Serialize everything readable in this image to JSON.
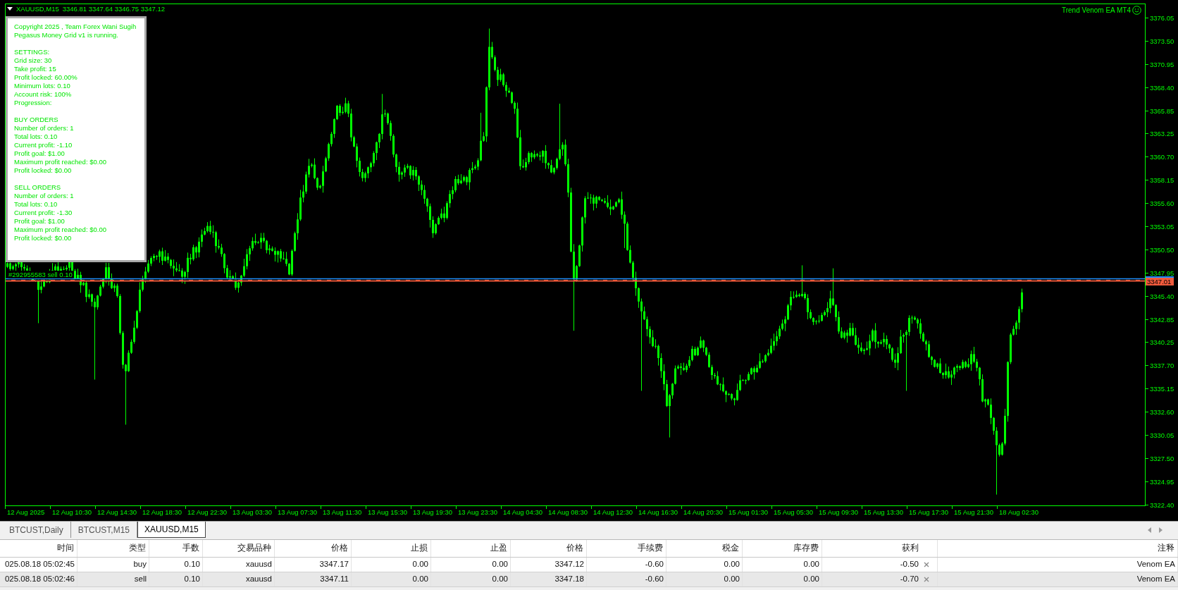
{
  "chart": {
    "header": {
      "symbol": "XAUUSD,M15",
      "quotes": "3346.81 3347.64 3346.75 3347.12"
    },
    "expert": {
      "name": "Trend Venom EA MT4",
      "enabled": true
    },
    "info_panel": {
      "intro": [
        "Copyright 2025 , Team Forex Wani Sugih",
        "Pegasus Money Grid v1 is running."
      ],
      "sections": [
        {
          "title": "SETTINGS:",
          "lines": [
            "Grid size: 30",
            "Take profit: 15",
            "Profit locked: 60.00%",
            "Minimum lots: 0.10",
            "Account risk: 100%",
            "Progression:"
          ]
        },
        {
          "title": "BUY ORDERS",
          "lines": [
            "Number of orders: 1",
            "Total lots: 0.10",
            "Current profit: -1.10",
            "Profit goal: $1.00",
            "Maximum profit reached: $0.00",
            "Profit locked: $0.00"
          ]
        },
        {
          "title": "SELL ORDERS",
          "lines": [
            "Number of orders: 1",
            "Total lots: 0.10",
            "Current profit: -1.30",
            "Profit goal: $1.00",
            "Maximum profit reached: $0.00",
            "Profit locked: $0.00"
          ]
        }
      ]
    },
    "order_label": "#292955583 sell 0.10",
    "price_label": "3347.01",
    "price_axis": [
      "3376.05",
      "3373.50",
      "3370.95",
      "3368.40",
      "3365.85",
      "3363.25",
      "3360.70",
      "3358.15",
      "3355.60",
      "3353.05",
      "3350.50",
      "3347.95",
      "3345.40",
      "3342.85",
      "3340.25",
      "3337.70",
      "3335.15",
      "3332.60",
      "3330.05",
      "3327.50",
      "3324.95",
      "3322.40"
    ],
    "time_axis": [
      "12 Aug 2025",
      "12 Aug 10:30",
      "12 Aug 14:30",
      "12 Aug 18:30",
      "12 Aug 22:30",
      "13 Aug 03:30",
      "13 Aug 07:30",
      "13 Aug 11:30",
      "13 Aug 15:30",
      "13 Aug 19:30",
      "13 Aug 23:30",
      "14 Aug 04:30",
      "14 Aug 08:30",
      "14 Aug 12:30",
      "14 Aug 16:30",
      "14 Aug 20:30",
      "15 Aug 01:30",
      "15 Aug 05:30",
      "15 Aug 09:30",
      "15 Aug 13:30",
      "15 Aug 17:30",
      "15 Aug 21:30",
      "18 Aug 02:30"
    ]
  },
  "tabs": [
    {
      "label": "BTCUST,Daily",
      "selected": false
    },
    {
      "label": "BTCUST,M15",
      "selected": false
    },
    {
      "label": "XAUUSD,M15",
      "selected": true
    }
  ],
  "trades": {
    "columns": [
      "时间",
      "类型",
      "手数",
      "交易品种",
      "价格",
      "止损",
      "止盈",
      "价格",
      "手续费",
      "税金",
      "库存费",
      "获利",
      "注释"
    ],
    "rows": [
      {
        "cells": [
          "025.08.18 05:02:45",
          "buy",
          "0.10",
          "xauusd",
          "3347.17",
          "0.00",
          "0.00",
          "3347.12",
          "-0.60",
          "0.00",
          "0.00",
          "-0.50",
          "Venom EA"
        ],
        "closable": true
      },
      {
        "cells": [
          "025.08.18 05:02:46",
          "sell",
          "0.10",
          "xauusd",
          "3347.11",
          "0.00",
          "0.00",
          "3347.18",
          "-0.60",
          "0.00",
          "0.00",
          "-0.70",
          "Venom EA"
        ],
        "closable": true
      }
    ]
  }
}
